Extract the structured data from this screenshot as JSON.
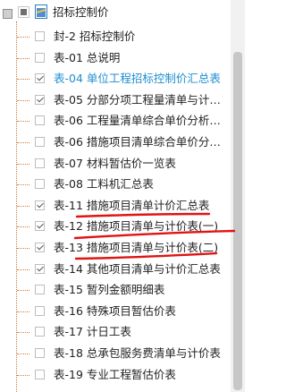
{
  "tree": {
    "root_label": "招标控制价",
    "items": [
      {
        "label": "封-2 招标控制价",
        "checked": false,
        "active": false
      },
      {
        "label": "表-01 总说明",
        "checked": false,
        "active": false
      },
      {
        "label": "表-04 单位工程招标控制价汇总表",
        "checked": true,
        "active": true
      },
      {
        "label": "表-05 分部分项工程量清单与计…",
        "checked": true,
        "active": false
      },
      {
        "label": "表-06 工程量清单综合单价分析…",
        "checked": false,
        "active": false
      },
      {
        "label": "表-06 措施项目清单综合单价分…",
        "checked": false,
        "active": false
      },
      {
        "label": "表-07 材料暂估价一览表",
        "checked": false,
        "active": false
      },
      {
        "label": "表-08 工料机汇总表",
        "checked": false,
        "active": false
      },
      {
        "label": "表-11 措施项目清单计价汇总表",
        "checked": true,
        "active": false
      },
      {
        "label": "表-12 措施项目清单与计价表(一)",
        "checked": true,
        "active": false
      },
      {
        "label": "表-13 措施项目清单与计价表(二)",
        "checked": true,
        "active": false
      },
      {
        "label": "表-14 其他项目清单与计价汇总表",
        "checked": true,
        "active": false
      },
      {
        "label": "表-15 暂列金额明细表",
        "checked": false,
        "active": false
      },
      {
        "label": "表-16 特殊项目暂估价表",
        "checked": false,
        "active": false
      },
      {
        "label": "表-17 计日工表",
        "checked": false,
        "active": false
      },
      {
        "label": "表-18 总承包服务费清单与计价表",
        "checked": false,
        "active": false
      },
      {
        "label": "表-19 专业工程暂估价表",
        "checked": false,
        "active": false
      }
    ]
  },
  "colors": {
    "active_text": "#1f8ed0",
    "annotation_red": "#e01414",
    "tree_line": "#d07c3a"
  }
}
